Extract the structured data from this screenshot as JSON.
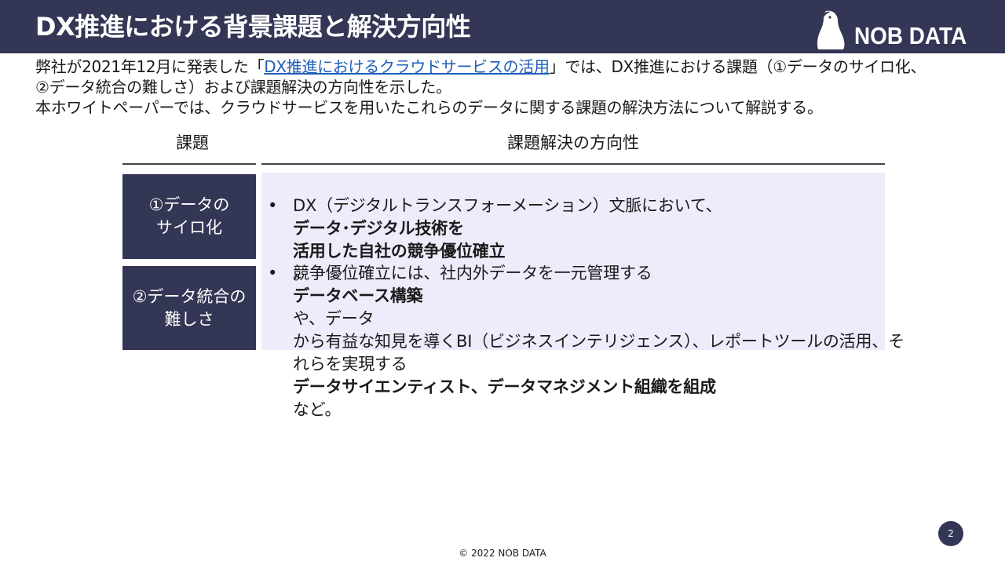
{
  "header": {
    "title": "DX推進における背景課題と解決方向性",
    "logo_text": "NOB DATA"
  },
  "intro": {
    "line1_prefix": "弊社が2021年12月に発表した「",
    "line1_link": "DX推進におけるクラウドサービスの活用",
    "line1_suffix": "」では、DX推進における課題（①データのサイロ化、",
    "line2": "②データ統合の難しさ）および課題解決の方向性を示した。",
    "line3": "本ホワイトペーパーでは、クラウドサービスを用いたこれらのデータに関する課題の解決方法について解説する。"
  },
  "table": {
    "col_issue": "課題",
    "col_direction": "課題解決の方向性",
    "rows": [
      {
        "issue_line1": "①データの",
        "issue_line2": "サイロ化"
      },
      {
        "issue_line1": "②データ統合の",
        "issue_line2": "難しさ"
      }
    ],
    "bullet_symbol": "•",
    "bullet1": {
      "a": "DX（デジタルトランスフォーメーション）文脈において、",
      "b": "データ･デジタル技術を",
      "c": "活用した自社の競争優位確立",
      "d": "。"
    },
    "bullet2": {
      "a": "競争優位確立には、社内外データを一元管理する",
      "b": "データベース構築",
      "c": "や、データ",
      "d": "から有益な知見を導くBI（ビジネスインテリジェンス）、レポートツールの活用、そ",
      "e": "れらを実現する",
      "f": "データサイエンティスト、データマネジメント組織を組成",
      "g": "など。"
    }
  },
  "footer": {
    "page_number": "2",
    "copyright": "© 2022 NOB DATA"
  },
  "colors": {
    "navy": "#333654",
    "panel_bg": "#eeebfb",
    "link": "#1f5fb8"
  }
}
